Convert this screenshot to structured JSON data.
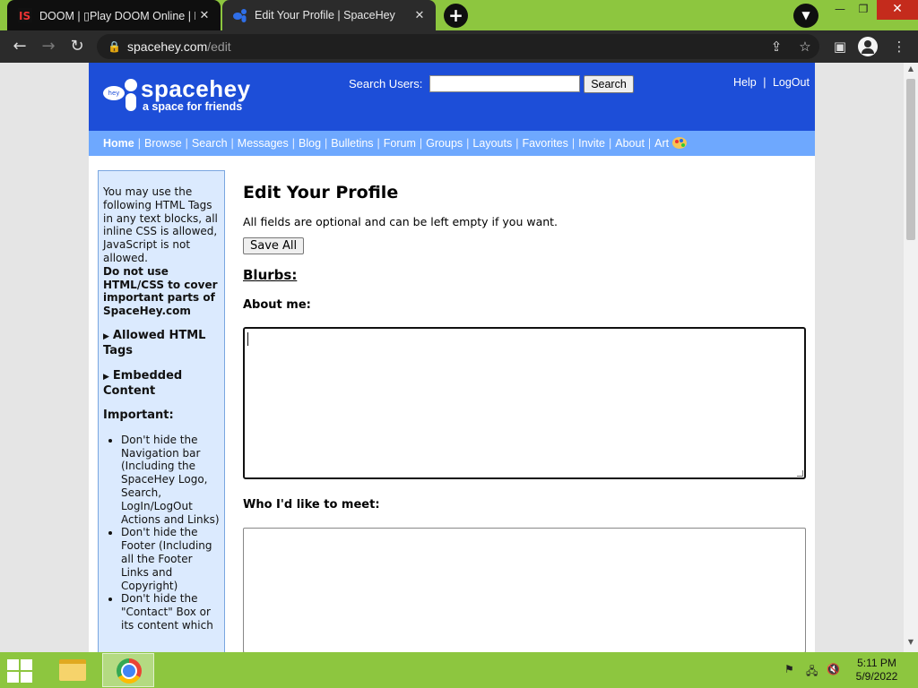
{
  "browser": {
    "tabs": [
      {
        "title": "DOOM | ▯Play DOOM Online | D…",
        "active": false,
        "favicon": "doom-favicon"
      },
      {
        "title": "Edit Your Profile | SpaceHey",
        "active": true,
        "favicon": "spacehey-favicon"
      }
    ],
    "new_tab": "+",
    "url_host": "spacehey.com",
    "url_path": "/edit"
  },
  "site": {
    "brand": "spacehey",
    "tagline": "a space for friends",
    "logo_badge": "hey",
    "search_label": "Search Users:",
    "search_value": "",
    "search_button": "Search",
    "help": "Help",
    "link_sep": "|",
    "logout": "LogOut",
    "nav": [
      "Home",
      "Browse",
      "Search",
      "Messages",
      "Blog",
      "Bulletins",
      "Forum",
      "Groups",
      "Layouts",
      "Favorites",
      "Invite",
      "About",
      "Art"
    ]
  },
  "sidebar": {
    "intro": "You may use the following HTML Tags in any text blocks, all inline CSS is allowed, JavaScript is not allowed.",
    "warning": "Do not use HTML/CSS to cover important parts of SpaceHey.com",
    "allowed_tags": "Allowed HTML Tags",
    "embedded": "Embedded Content",
    "important": "Important:",
    "rules": [
      "Don't hide the Navigation bar (Including the SpaceHey Logo, Search, LogIn/LogOut Actions and Links)",
      "Don't hide the Footer (Including all the Footer Links and Copyright)",
      "Don't hide the \"Contact\" Box or its content which"
    ]
  },
  "main": {
    "title": "Edit Your Profile",
    "intro": "All fields are optional and can be left empty if you want.",
    "save_all": "Save All",
    "section": "Blurbs:",
    "about_label": "About me:",
    "about_value": "",
    "meet_label": "Who I'd like to meet:",
    "meet_value": ""
  },
  "taskbar": {
    "time": "5:11 PM",
    "date": "5/9/2022"
  },
  "colors": {
    "header_blue": "#1d4ed8",
    "nav_blue": "#6ea8fe",
    "sidebar_bg": "#dbeafe",
    "taskbar_green": "#8dc63f"
  }
}
